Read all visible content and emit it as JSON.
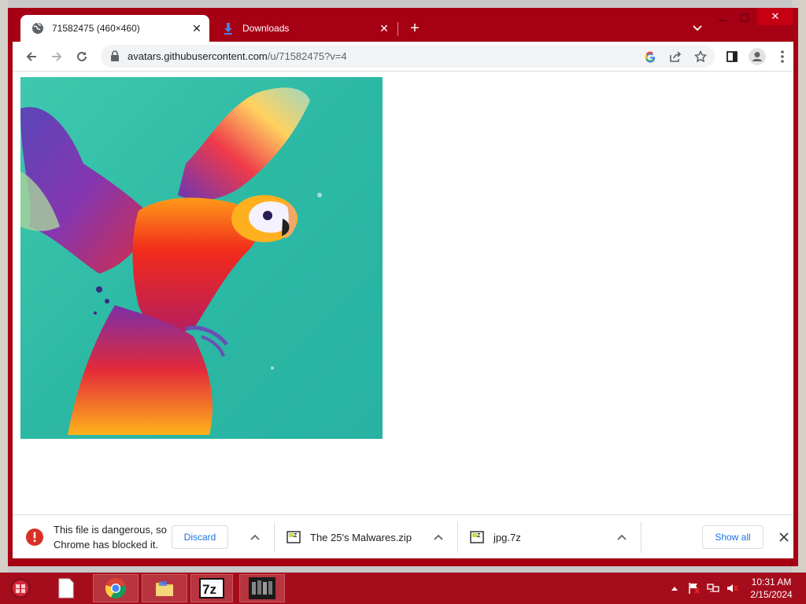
{
  "tabs": [
    {
      "title": "71582475 (460×460)",
      "icon": "globe-icon",
      "active": true
    },
    {
      "title": "Downloads",
      "icon": "download-icon",
      "active": false
    }
  ],
  "toolbar": {
    "url_host": "avatars.githubusercontent.com",
    "url_path": "/u/71582475?v=4"
  },
  "downloads": {
    "blocked_message_line1": "This file is dangerous, so",
    "blocked_message_line2": "Chrome has blocked it.",
    "discard_label": "Discard",
    "items": [
      {
        "filename": "The 25's Malwares.zip",
        "icon": "archive-icon"
      },
      {
        "filename": "jpg.7z",
        "icon": "archive-icon"
      }
    ],
    "show_all_label": "Show all"
  },
  "taskbar": {
    "time": "10:31 AM",
    "date": "2/15/2024"
  },
  "colors": {
    "window_frame": "#a60014",
    "taskbar": "#a50d1d",
    "link_blue": "#1a73e8",
    "danger_red": "#d93025",
    "image_bg": "#2ebfa5"
  }
}
